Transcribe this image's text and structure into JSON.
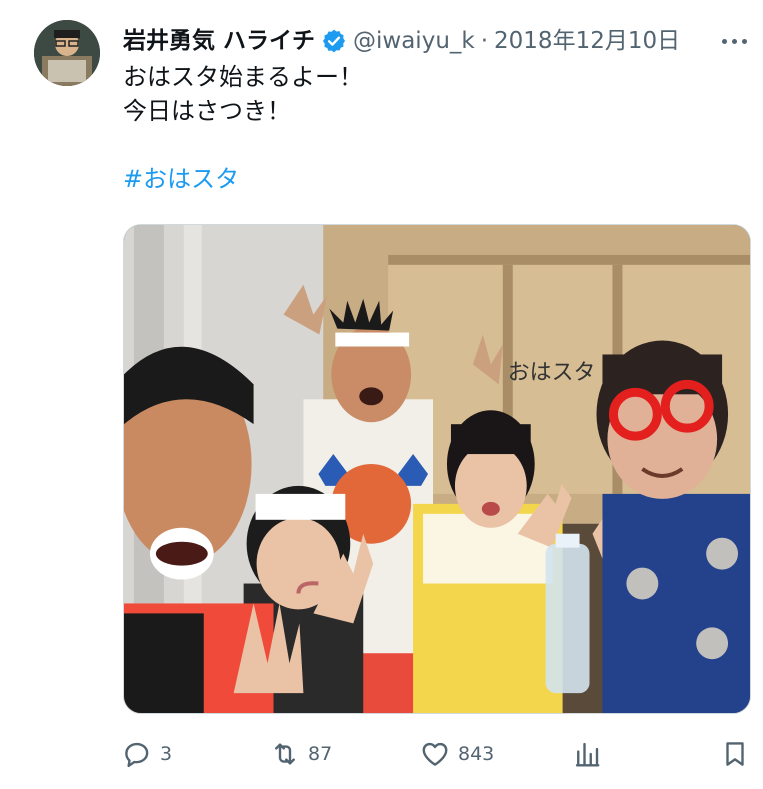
{
  "author": {
    "display_name": "岩井勇気 ハライチ",
    "handle": "@iwaiyu_k",
    "verified_icon": "verified-badge-icon",
    "avatar_icon": "avatar"
  },
  "tweet": {
    "separator": "·",
    "date": "2018年12月10日",
    "lines": [
      "おはスタ始まるよー！",
      "今日はさつき！"
    ],
    "hashtag": "#おはスタ"
  },
  "media": {
    "sign_text": "おはスタ"
  },
  "actions": {
    "replies": "3",
    "retweets": "87",
    "likes": "843",
    "reply_icon": "reply-icon",
    "retweet_icon": "retweet-icon",
    "like_icon": "heart-icon",
    "views_icon": "views-icon",
    "bookmark_icon": "bookmark-icon"
  },
  "colors": {
    "text": "#0f1419",
    "secondary": "#536471",
    "accent": "#1d9bf0"
  }
}
